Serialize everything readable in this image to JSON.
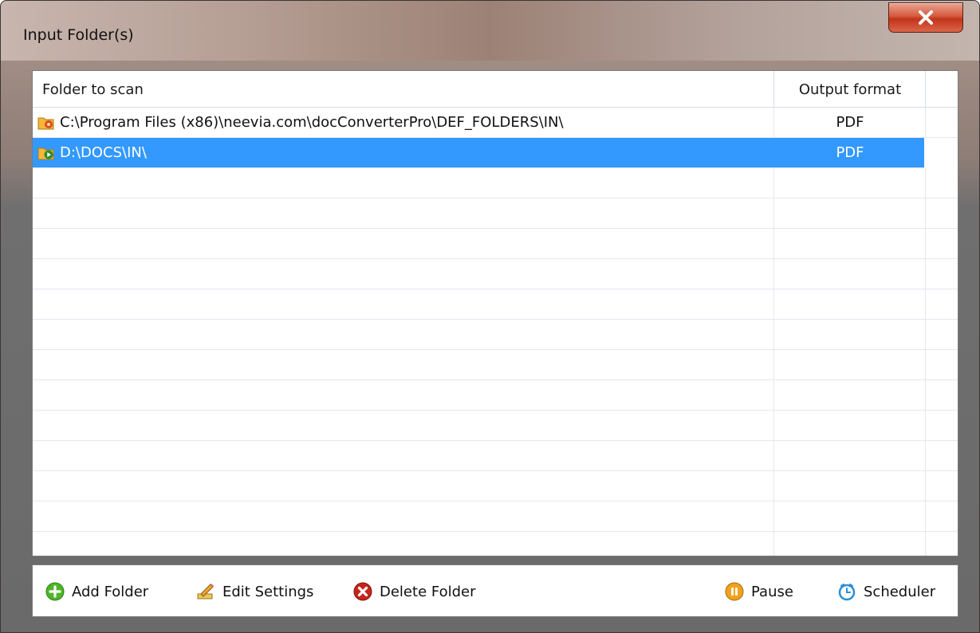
{
  "window": {
    "title": "Input Folder(s)"
  },
  "list": {
    "columns": {
      "folder": "Folder to scan",
      "format": "Output format"
    },
    "rows": [
      {
        "folder": "C:\\Program Files (x86)\\neevia.com\\docConverterPro\\DEF_FOLDERS\\IN\\",
        "format": "PDF",
        "icon": "folder-gear-icon",
        "selected": false
      },
      {
        "folder": "D:\\DOCS\\IN\\",
        "format": "PDF",
        "icon": "folder-play-icon",
        "selected": true
      }
    ]
  },
  "toolbar": {
    "add_label": "Add Folder",
    "edit_label": "Edit Settings",
    "delete_label": "Delete Folder",
    "pause_label": "Pause",
    "scheduler_label": "Scheduler"
  },
  "colors": {
    "selection": "#3399ff",
    "add_icon": "#4fb52a",
    "delete_icon": "#c8241b",
    "pause_icon": "#f0a21e",
    "scheduler_icon": "#2a8fd6"
  }
}
